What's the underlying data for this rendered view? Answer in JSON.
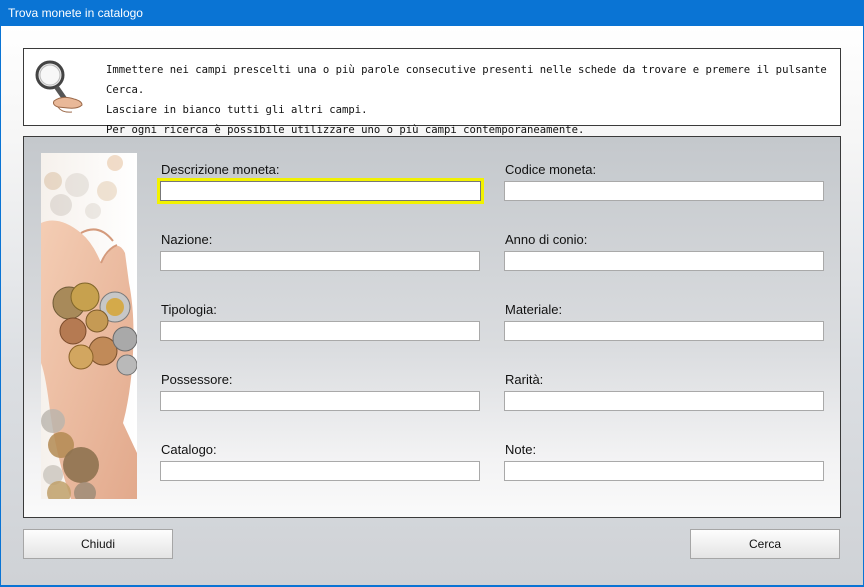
{
  "window": {
    "title": "Trova monete in catalogo"
  },
  "info": {
    "lines": [
      "Immettere nei campi prescelti una o più parole consecutive presenti nelle schede da trovare e premere il pulsante Cerca.",
      "Lasciare in bianco tutti gli altri campi.",
      "Per ogni ricerca è possibile utilizzare uno o più campi contemporaneamente."
    ],
    "icon": "magnifier-hand-icon"
  },
  "fields": {
    "descrizione": {
      "label": "Descrizione moneta:",
      "value": ""
    },
    "codice": {
      "label": "Codice moneta:",
      "value": ""
    },
    "nazione": {
      "label": "Nazione:",
      "value": ""
    },
    "anno": {
      "label": "Anno di conio:",
      "value": ""
    },
    "tipologia": {
      "label": "Tipologia:",
      "value": ""
    },
    "materiale": {
      "label": "Materiale:",
      "value": ""
    },
    "possessore": {
      "label": "Possessore:",
      "value": ""
    },
    "rarita": {
      "label": "Rarità:",
      "value": ""
    },
    "catalogo": {
      "label": "Catalogo:",
      "value": ""
    },
    "note": {
      "label": "Note:",
      "value": ""
    }
  },
  "buttons": {
    "close": "Chiudi",
    "search": "Cerca"
  },
  "colors": {
    "titlebar": "#0a74d4",
    "focus": "#f2f200"
  }
}
